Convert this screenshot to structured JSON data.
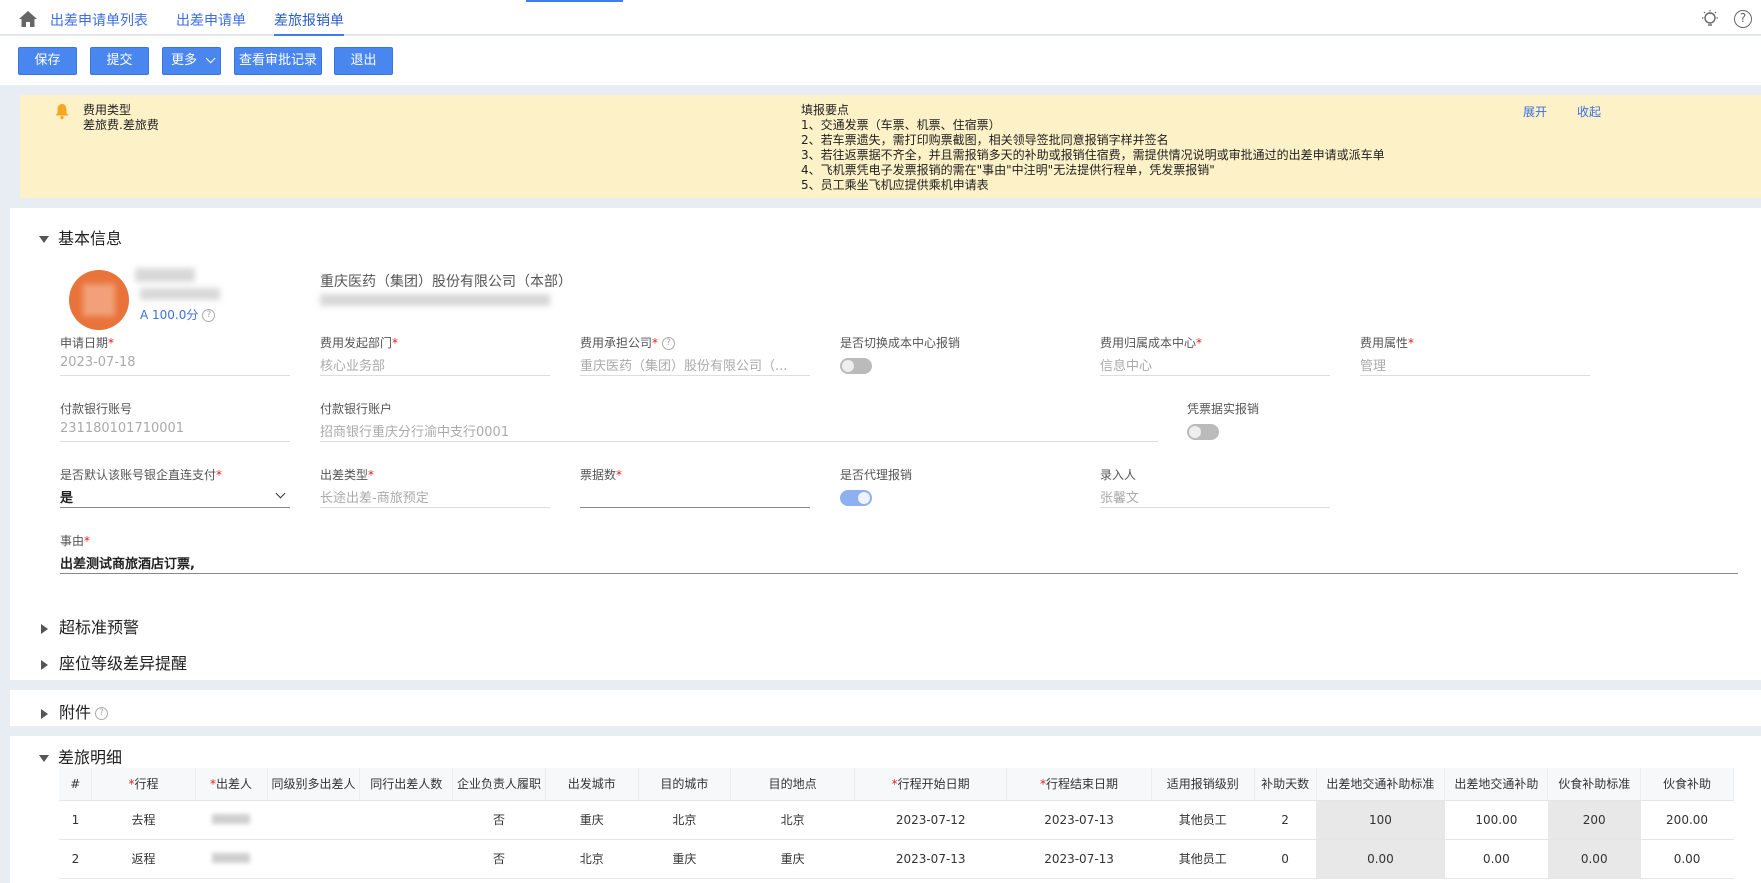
{
  "nav": {
    "tabs": [
      "出差申请单列表",
      "出差申请单",
      "差旅报销单"
    ],
    "help_label": "?"
  },
  "toolbar": {
    "save": "保存",
    "submit": "提交",
    "more": "更多",
    "approval_log": "查看审批记录",
    "exit": "退出"
  },
  "notice": {
    "type_label": "费用类型",
    "type_value": "差旅费.差旅费",
    "points_title": "填报要点",
    "points": [
      "1、交通发票（车票、机票、住宿票）",
      "2、若车票遗失，需打印购票截图，相关领导签批同意报销字样并签名",
      "3、若往返票据不齐全，并且需报销多天的补助或报销住宿费，需提供情况说明或审批通过的出差申请或派车单",
      "4、飞机票凭电子发票报销的需在\"事由\"中注明\"无法提供行程单，凭发票报销\"",
      "5、员工乘坐飞机应提供乘机申请表"
    ],
    "expand": "展开",
    "collapse": "收起"
  },
  "basic": {
    "title": "基本信息",
    "score": "A 100.0分",
    "company": "重庆医药（集团）股份有限公司（本部）",
    "fields": {
      "apply_date": {
        "label": "申请日期",
        "value": "2023-07-18"
      },
      "dept": {
        "label": "费用发起部门",
        "value": "核心业务部"
      },
      "bear_company": {
        "label": "费用承担公司",
        "value": "重庆医药（集团）股份有限公司（..."
      },
      "switch_cost": {
        "label": "是否切换成本中心报销"
      },
      "cost_center": {
        "label": "费用归属成本中心",
        "value": "信息中心"
      },
      "cost_attr": {
        "label": "费用属性",
        "value": "管理"
      },
      "bank_no": {
        "label": "付款银行账号",
        "value": "231180101710001"
      },
      "bank_account": {
        "label": "付款银行账户",
        "value": "招商银行重庆分行渝中支行0001"
      },
      "invoice_real": {
        "label": "凭票据实报销"
      },
      "default_pay": {
        "label": "是否默认该账号银企直连支付",
        "value": "是"
      },
      "trip_type": {
        "label": "出差类型",
        "value": "长途出差-商旅预定"
      },
      "bill_count": {
        "label": "票据数",
        "value": ""
      },
      "proxy": {
        "label": "是否代理报销"
      },
      "recorder": {
        "label": "录入人",
        "value": "张馨文"
      },
      "reason": {
        "label": "事由",
        "value": "出差测试商旅酒店订票,"
      }
    }
  },
  "sections": {
    "over_standard": "超标准预警",
    "seat_diff": "座位等级差异提醒",
    "attachment": "附件",
    "travel_detail": "差旅明细"
  },
  "table": {
    "headers": [
      "#",
      "行程",
      "出差人",
      "同级别多出差人",
      "同行出差人数",
      "企业负责人履职",
      "出发城市",
      "目的城市",
      "目的地点",
      "行程开始日期",
      "行程结束日期",
      "适用报销级别",
      "补助天数",
      "出差地交通补助标准",
      "出差地交通补助",
      "伙食补助标准",
      "伙食补助"
    ],
    "rows": [
      [
        "1",
        "去程",
        "",
        "",
        "",
        "否",
        "重庆",
        "北京",
        "北京",
        "2023-07-12",
        "2023-07-13",
        "其他员工",
        "2",
        "100",
        "100.00",
        "200",
        "200.00"
      ],
      [
        "2",
        "返程",
        "",
        "",
        "",
        "否",
        "北京",
        "重庆",
        "重庆",
        "2023-07-13",
        "2023-07-13",
        "其他员工",
        "0",
        "0.00",
        "0.00",
        "0.00",
        "0.00"
      ]
    ]
  },
  "colors": {
    "primary": "#4a86f0",
    "notice_bg": "#fdf1c8",
    "link": "#3d6ee0",
    "required": "#e02020"
  }
}
